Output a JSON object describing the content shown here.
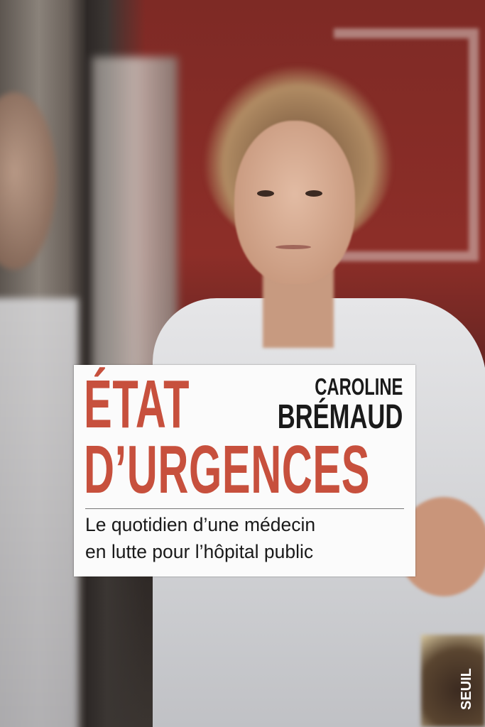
{
  "book": {
    "title_line1": "ÉTAT",
    "title_line2": "D’URGENCES",
    "author_first": "CAROLINE",
    "author_last": "BRÉMAUD",
    "subtitle_line1": "Le quotidien d’une médecin",
    "subtitle_line2": "en lutte pour l’hôpital public",
    "publisher": "SEUIL"
  },
  "colors": {
    "title": "#c7503d",
    "text": "#1a1a1a",
    "card": "#fbfbfb"
  }
}
